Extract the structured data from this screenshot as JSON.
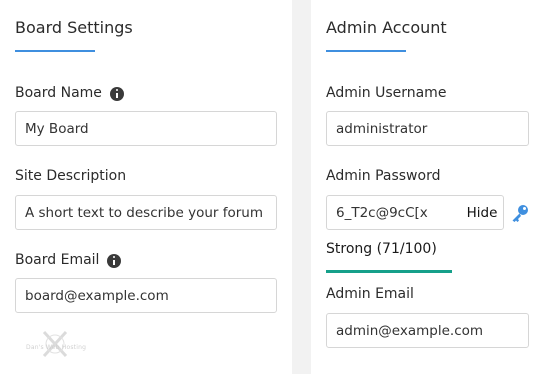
{
  "board_settings": {
    "title": "Board Settings",
    "board_name": {
      "label": "Board Name",
      "value": "My Board"
    },
    "site_description": {
      "label": "Site Description",
      "value": "A short text to describe your forum"
    },
    "board_email": {
      "label": "Board Email",
      "value": "board@example.com"
    }
  },
  "admin_account": {
    "title": "Admin Account",
    "username": {
      "label": "Admin Username",
      "value": "administrator"
    },
    "password": {
      "label": "Admin Password",
      "value": "6_T2c@9cC[x",
      "toggle_label": "Hide",
      "strength_text": "Strong (71/100)",
      "strength_score": 71
    },
    "email": {
      "label": "Admin Email",
      "value": "admin@example.com"
    }
  },
  "watermark": {
    "text": "Dan's Web Hosting"
  },
  "colors": {
    "accent": "#3f8fdf",
    "strength": "#16a08a",
    "key_icon": "#3f8fdf"
  },
  "icons": [
    "info-icon",
    "key-icon"
  ]
}
